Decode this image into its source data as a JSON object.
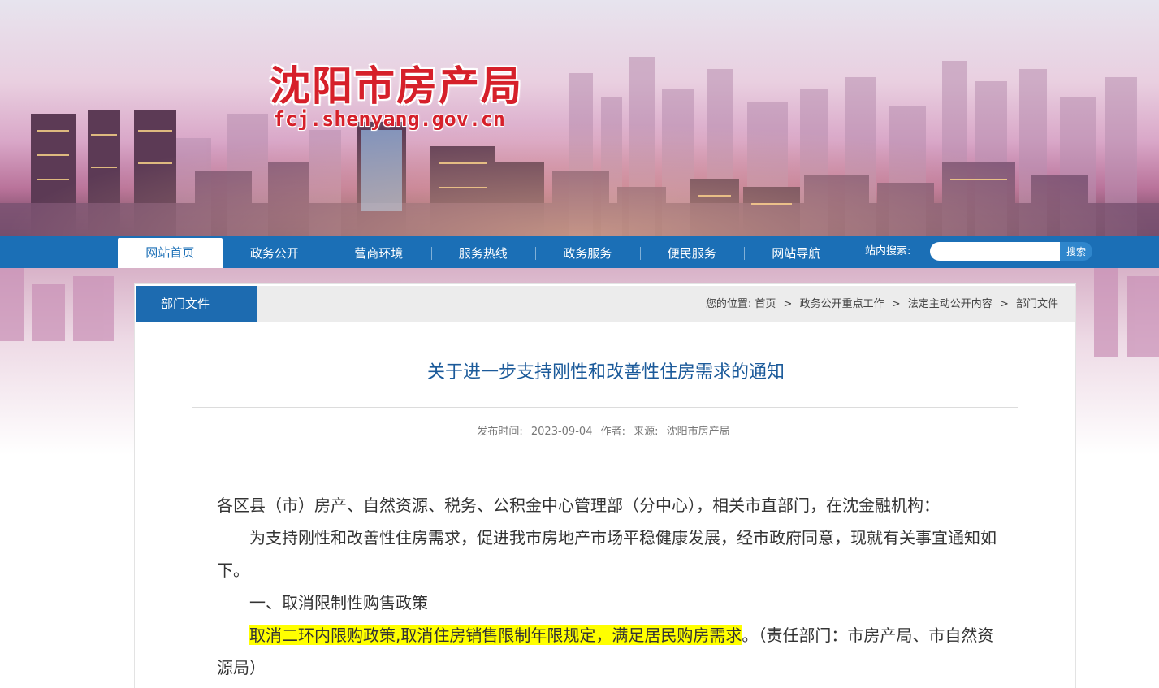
{
  "site": {
    "title": "沈阳市房产局",
    "url": "fcj.shenyang.gov.cn"
  },
  "nav": {
    "items": [
      {
        "label": "网站首页",
        "active": true
      },
      {
        "label": "政务公开"
      },
      {
        "label": "营商环境"
      },
      {
        "label": "服务热线"
      },
      {
        "label": "政务服务"
      },
      {
        "label": "便民服务"
      },
      {
        "label": "网站导航"
      }
    ],
    "search_label": "站内搜索:",
    "search_placeholder": "",
    "search_button": "搜索"
  },
  "panel": {
    "tab_label": "部门文件",
    "breadcrumb": {
      "prefix": "您的位置:",
      "items": [
        "首页",
        "政务公开重点工作",
        "法定主动公开内容",
        "部门文件"
      ],
      "separator": ">"
    }
  },
  "article": {
    "title": "关于进一步支持刚性和改善性住房需求的通知",
    "meta": {
      "published_label": "发布时间:",
      "published": "2023-09-04",
      "author_label": "作者:",
      "source_label": "来源:",
      "source": "沈阳市房产局"
    },
    "paragraphs": {
      "p1": "各区县（市）房产、自然资源、税务、公积金中心管理部（分中心），相关市直部门，在沈金融机构：",
      "p2": "为支持刚性和改善性住房需求，促进我市房地产市场平稳健康发展，经市政府同意，现就有关事宜通知如下。",
      "p3": "一、取消限制性购售政策",
      "p4_highlight": "取消二环内限购政策,取消住房销售限制年限规定，满足居民购房需求",
      "p4_rest": "。（责任部门：市房产局、市自然资源局）"
    }
  },
  "colors": {
    "nav_bg": "#1b6fb6",
    "tab_bg": "#1d6bb0",
    "title_red": "#d6202a",
    "article_title": "#1b5a9a",
    "highlight": "#ffff00"
  }
}
